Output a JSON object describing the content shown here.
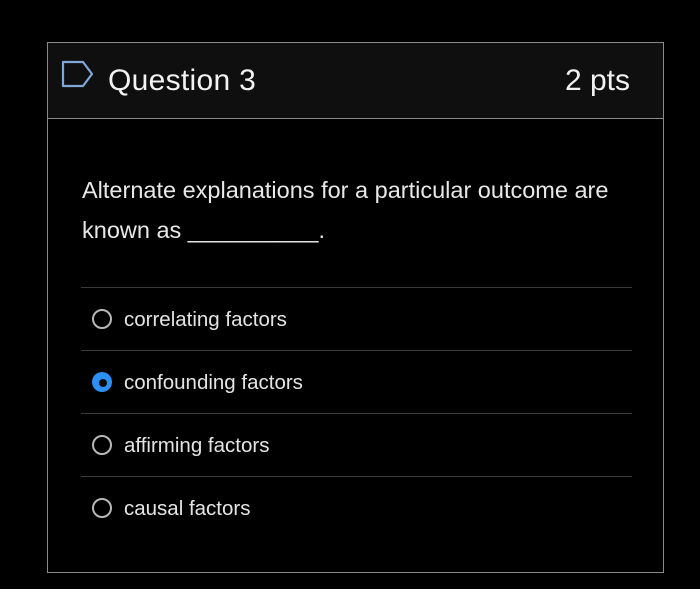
{
  "question": {
    "title": "Question 3",
    "points": "2 pts",
    "flag_icon": "flag-icon",
    "text": "Alternate explanations for a particular outcome are known as __________."
  },
  "answers": [
    {
      "label": "correlating factors",
      "selected": false
    },
    {
      "label": "confounding factors",
      "selected": true
    },
    {
      "label": "affirming factors",
      "selected": false
    },
    {
      "label": "causal factors",
      "selected": false
    }
  ],
  "colors": {
    "background": "#000000",
    "header_background": "#0f0f10",
    "border": "#8a8a8a",
    "accent": "#2b8ff6",
    "text": "#e6e6e6"
  }
}
